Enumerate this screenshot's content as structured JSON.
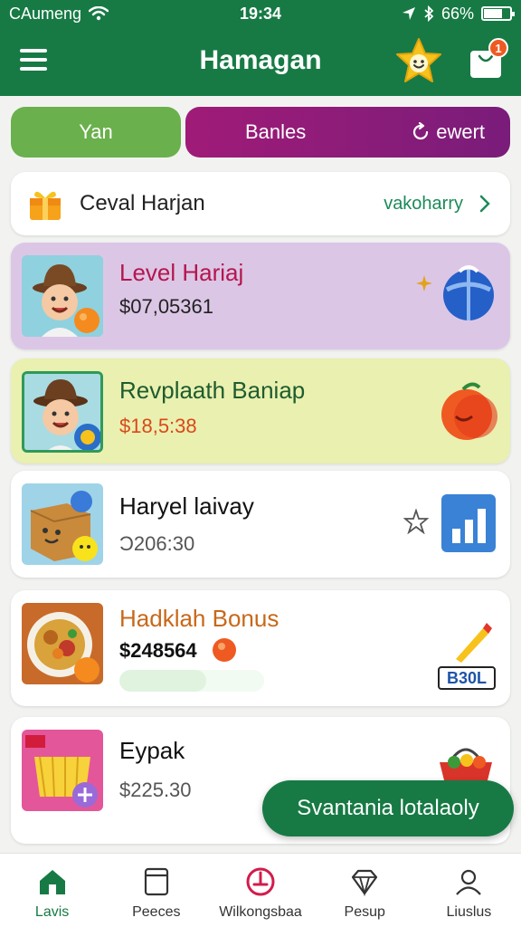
{
  "status_bar": {
    "carrier": "CAumeng",
    "time": "19:34",
    "battery": "66%"
  },
  "app_bar": {
    "title": "Hamagan",
    "bag_badge": "1"
  },
  "tabs": [
    {
      "label": "Yan"
    },
    {
      "label": "Banles",
      "event_label": "ewert"
    }
  ],
  "banner": {
    "title": "Ceval Harjan",
    "link": "vakoharry"
  },
  "cards": [
    {
      "title": "Level Hariaj",
      "amount": "$07,05361"
    },
    {
      "title": "Revplaath Baniap",
      "amount": "$18,5:38"
    },
    {
      "title": "Haryel laivay",
      "amount": "Ɔ206:30"
    },
    {
      "title": "Hadklah Bonus",
      "amount": "$248564",
      "badge": "B30L",
      "progress": 0.6
    },
    {
      "title": "Eypak",
      "amount": "$225.30"
    }
  ],
  "cta": {
    "label": "Svantania lotalaoly"
  },
  "bottom_nav": [
    {
      "label": "Lavis",
      "icon": "home-icon",
      "active": true
    },
    {
      "label": "Peeces",
      "icon": "document-icon"
    },
    {
      "label": "Wilkongsbaa",
      "icon": "target-icon"
    },
    {
      "label": "Pesup",
      "icon": "diamond-icon"
    },
    {
      "label": "Liuslus",
      "icon": "profile-icon"
    }
  ],
  "colors": {
    "primary": "#177a45",
    "purple_tab": "#a01b78",
    "green_tab": "#6ab04c",
    "accent_orange": "#ef5a22"
  }
}
